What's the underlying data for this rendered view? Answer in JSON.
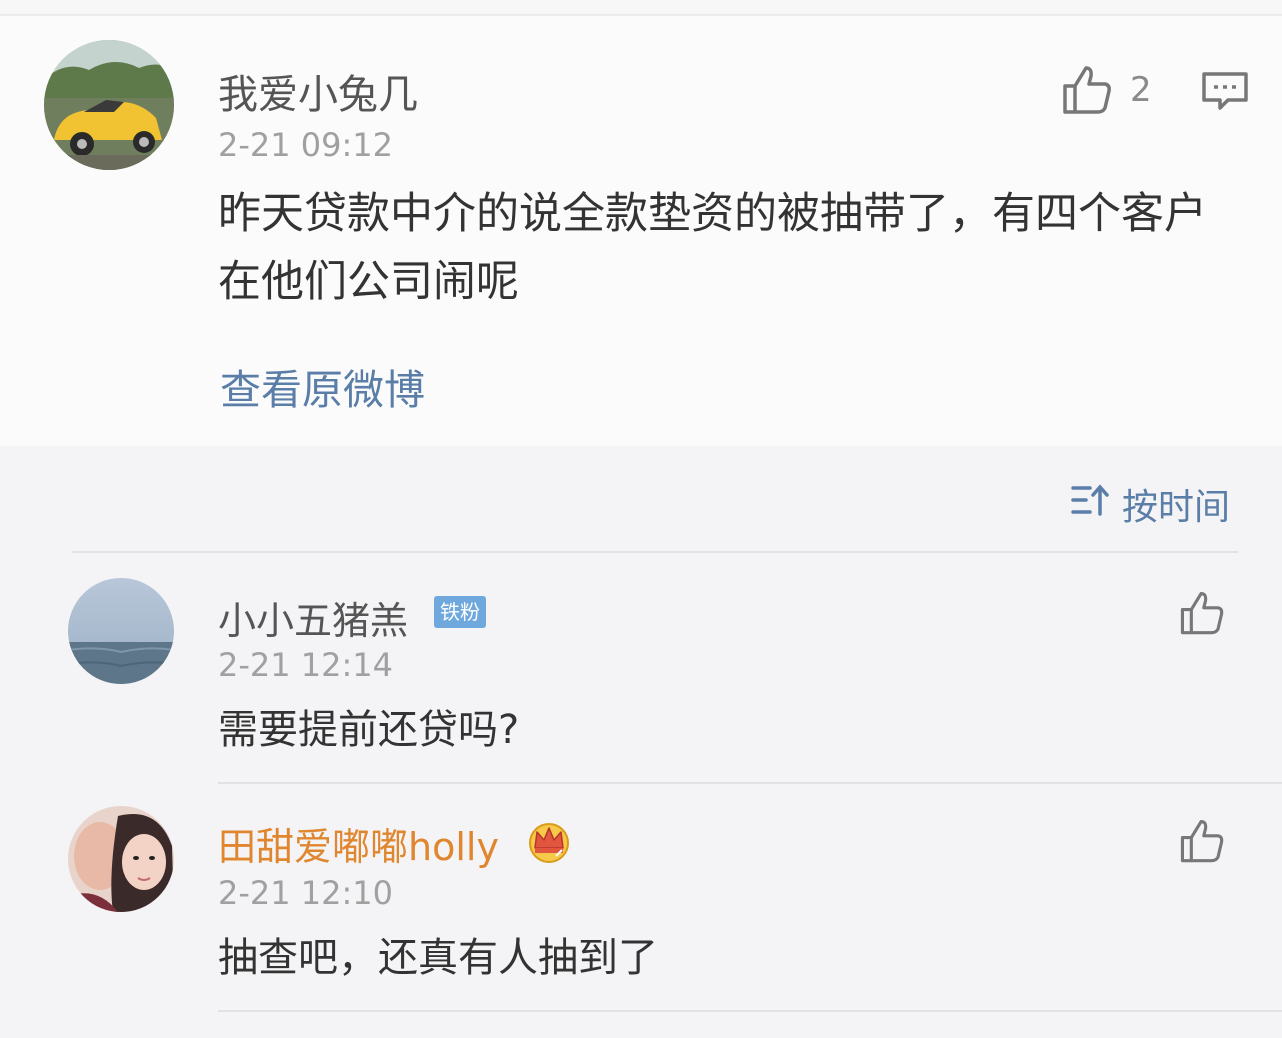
{
  "post": {
    "author": "我爱小兔几",
    "time": "2-21 09:12",
    "text": "昨天贷款中介的说全款垫资的被抽带了，有四个客户在他们公司闹呢",
    "like_count": "2",
    "view_original": "查看原微博"
  },
  "sort": {
    "label": "按时间"
  },
  "comments": [
    {
      "author": "小小五猪羔",
      "badge": "铁粉",
      "time": "2-21 12:14",
      "text": "需要提前还贷吗?"
    },
    {
      "author": "田甜爱嘟嘟holly",
      "time": "2-21 12:10",
      "text": "抽查吧，还真有人抽到了"
    }
  ],
  "colors": {
    "link": "#5a7ea8",
    "vip_name": "#e0862e",
    "badge": "#6fa8dc"
  },
  "icons": [
    "thumbs-up-icon",
    "comment-icon",
    "sort-icon",
    "crown-icon"
  ]
}
